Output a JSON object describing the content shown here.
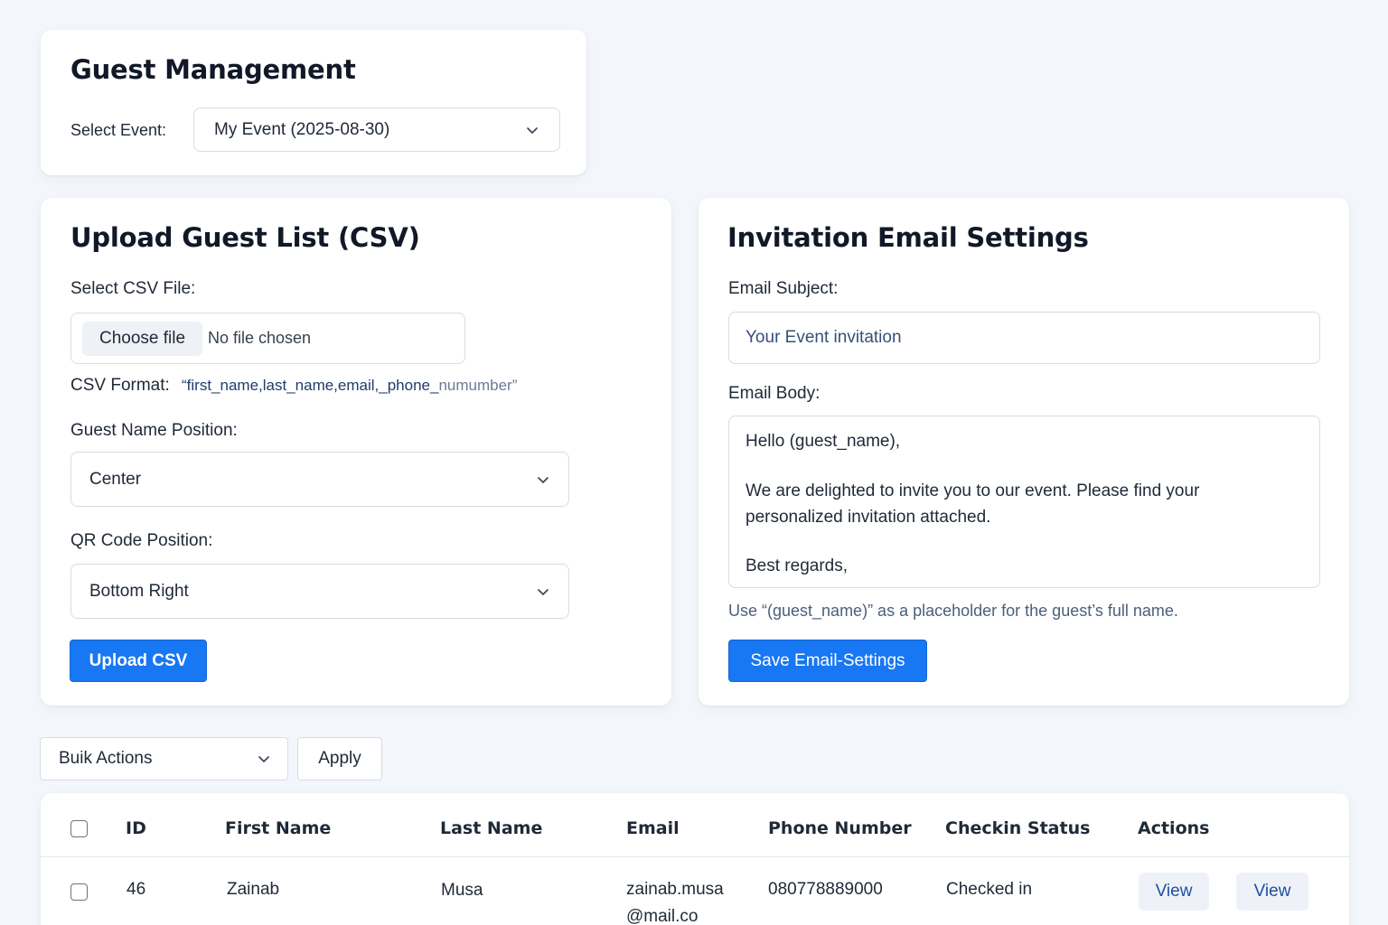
{
  "header": {
    "title": "Guest Management",
    "select_event_label": "Select Event:",
    "selected_event": "My Event (2025-08-30)"
  },
  "upload": {
    "title": "Upload Guest List (CSV)",
    "file_label": "Select CSV File:",
    "choose_file_label": "Choose file",
    "no_file_text": "No file chosen",
    "format_label": "CSV Format:",
    "format_value_main": "“first_name,last_name,email,_phone_",
    "format_value_tail": "numumber”",
    "name_position_label": "Guest Name Position:",
    "name_position_value": "Center",
    "qr_position_label": "QR Code Position:",
    "qr_position_value": "Bottom Right",
    "upload_button": "Upload CSV"
  },
  "email": {
    "title": "Invitation Email Settings",
    "subject_label": "Email Subject:",
    "subject_value": "Your Event invitation",
    "body_label": "Email Body:",
    "body_line1": "Hello (guest_name),",
    "body_line2": "We are delighted to invite you to our event. Please find your",
    "body_line3": "personalized invitation attached.",
    "body_line4": "Best regards,",
    "placeholder_hint": "Use “(guest_name)” as a placeholder for the guest’s full name.",
    "save_button": "Save Email-Settings"
  },
  "bulk": {
    "selected_action": "Buik Actions",
    "apply_button": "Apply"
  },
  "table": {
    "headers": {
      "id": "ID",
      "first_name": "First Name",
      "last_name": "Last Name",
      "email": "Email",
      "phone": "Phone Number",
      "status": "Checkin Status",
      "actions": "Actions"
    },
    "rows": [
      {
        "id": "46",
        "first_name": "Zainab",
        "last_name": "Musa",
        "email_line1": "zainab.musa",
        "email_line2": "@mail.co",
        "phone": "080778889000",
        "status": "Checked in",
        "action1": "View",
        "action2": "View"
      }
    ]
  },
  "colors": {
    "primary": "#1877f2",
    "page_background": "#f3f6fb"
  }
}
